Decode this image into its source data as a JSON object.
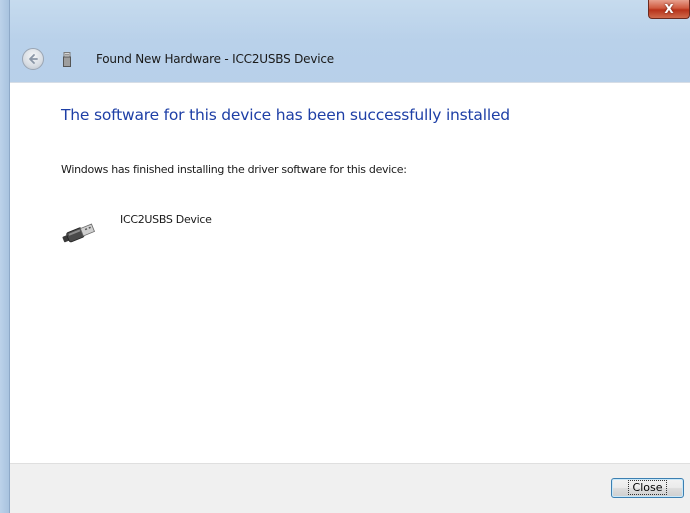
{
  "window": {
    "close_glyph": "X"
  },
  "header": {
    "back_icon": "back-arrow-icon",
    "device_icon": "usb-device-icon",
    "title": "Found New Hardware - ICC2USBS Device"
  },
  "main": {
    "heading": "The software for this device has been successfully installed",
    "message": "Windows has finished installing the driver software for this device:",
    "device": {
      "icon": "usb-plug-icon",
      "name": "ICC2USBS Device"
    }
  },
  "footer": {
    "close_label": "Close"
  },
  "colors": {
    "heading": "#1e3fa6",
    "frame": "#b9d1ea",
    "close_red": "#c8432a"
  }
}
